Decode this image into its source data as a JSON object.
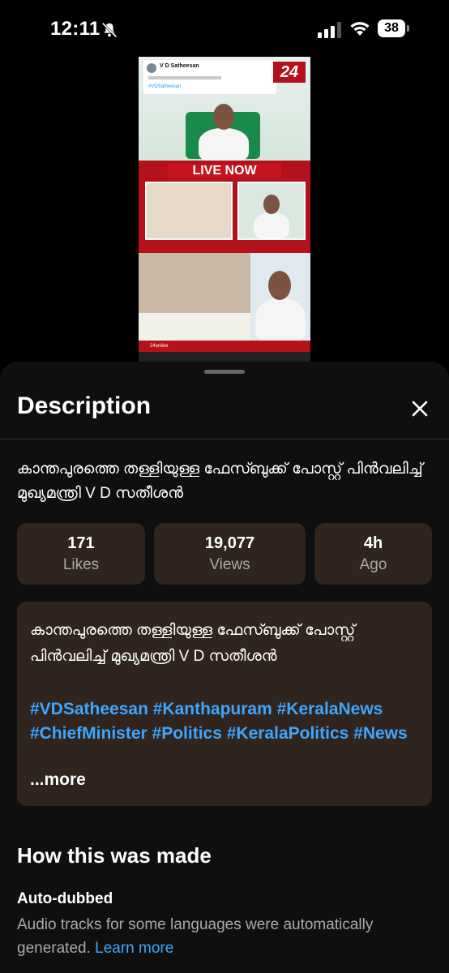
{
  "status_bar": {
    "time": "12:11",
    "battery": "38"
  },
  "video": {
    "tweet_name": "V D Satheesan",
    "tweet_hashtag": "#VDSatheesan",
    "channel_logo": "24",
    "live_label": "LIVE NOW",
    "ticker_text": "24onlive"
  },
  "sheet": {
    "title": "Description",
    "video_title": "കാന്തപുരത്തെ തള്ളിയുള്ള ഫേസ്ബുക്ക് പോസ്റ്റ് പിൻവലിച്ച് മുഖ്യമന്ത്രി V D സതീശൻ",
    "stats": [
      {
        "value": "171",
        "label": "Likes"
      },
      {
        "value": "19,077",
        "label": "Views"
      },
      {
        "value": "4h",
        "label": "Ago"
      }
    ],
    "description": "കാന്തപുരത്തെ തള്ളിയുള്ള ഫേസ്ബുക്ക് പോസ്റ്റ് പിൻവലിച്ച് മുഖ്യമന്ത്രി V D സതീശൻ",
    "hashtags": "#VDSatheesan #Kanthapuram #KeralaNews #ChiefMinister #Politics #KeralaPolitics #News",
    "more_label": "...more",
    "how_made_title": "How this was made",
    "auto_dubbed_title": "Auto-dubbed",
    "auto_dubbed_text": "Audio tracks for some languages were automatically generated.",
    "learn_more": "Learn more"
  }
}
